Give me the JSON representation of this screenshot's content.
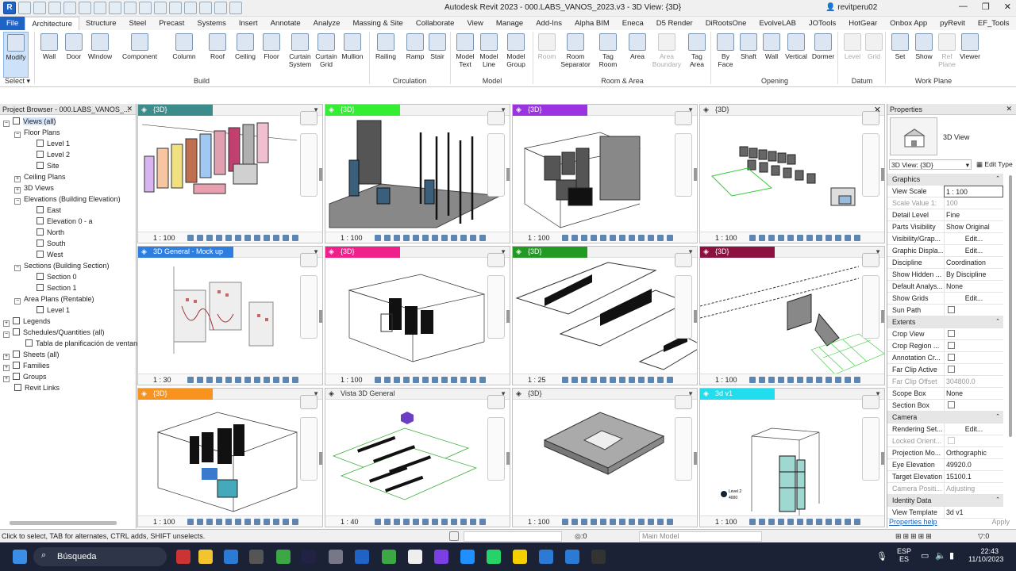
{
  "app": {
    "title": "Autodesk Revit 2023 - 000.LABS_VANOS_2023.v3 - 3D View: {3D}",
    "user": "revitperu02",
    "logo": "R"
  },
  "tabs": [
    "File",
    "Architecture",
    "Structure",
    "Steel",
    "Precast",
    "Systems",
    "Insert",
    "Annotate",
    "Analyze",
    "Massing & Site",
    "Collaborate",
    "View",
    "Manage",
    "Add-Ins",
    "Alpha BIM",
    "Eneca",
    "D5 Render",
    "DiRootsOne",
    "EvolveLAB",
    "JOTools",
    "HotGear",
    "Onbox App",
    "pyRevit",
    "EF_Tools"
  ],
  "ribbon": {
    "buttons": [
      {
        "l1": "Modify",
        "l2": ""
      },
      {
        "l1": "Wall",
        "l2": ""
      },
      {
        "l1": "Door",
        "l2": ""
      },
      {
        "l1": "Window",
        "l2": ""
      },
      {
        "l1": "Component",
        "l2": ""
      },
      {
        "l1": "Column",
        "l2": ""
      },
      {
        "l1": "Roof",
        "l2": ""
      },
      {
        "l1": "Ceiling",
        "l2": ""
      },
      {
        "l1": "Floor",
        "l2": ""
      },
      {
        "l1": "Curtain",
        "l2": "System"
      },
      {
        "l1": "Curtain",
        "l2": "Grid"
      },
      {
        "l1": "Mullion",
        "l2": ""
      },
      {
        "l1": "Railing",
        "l2": ""
      },
      {
        "l1": "Ramp",
        "l2": ""
      },
      {
        "l1": "Stair",
        "l2": ""
      },
      {
        "l1": "Model",
        "l2": "Text"
      },
      {
        "l1": "Model",
        "l2": "Line"
      },
      {
        "l1": "Model",
        "l2": "Group"
      },
      {
        "l1": "Room",
        "l2": ""
      },
      {
        "l1": "Room",
        "l2": "Separator"
      },
      {
        "l1": "Tag",
        "l2": "Room"
      },
      {
        "l1": "Area",
        "l2": ""
      },
      {
        "l1": "Area",
        "l2": "Boundary"
      },
      {
        "l1": "Tag",
        "l2": "Area"
      },
      {
        "l1": "By",
        "l2": "Face"
      },
      {
        "l1": "Shaft",
        "l2": ""
      },
      {
        "l1": "Wall",
        "l2": ""
      },
      {
        "l1": "Vertical",
        "l2": ""
      },
      {
        "l1": "Dormer",
        "l2": ""
      },
      {
        "l1": "Level",
        "l2": ""
      },
      {
        "l1": "Grid",
        "l2": ""
      },
      {
        "l1": "Set",
        "l2": ""
      },
      {
        "l1": "Show",
        "l2": ""
      },
      {
        "l1": "Ref",
        "l2": "Plane"
      },
      {
        "l1": "Viewer",
        "l2": ""
      }
    ],
    "panels": [
      "Select",
      "Build",
      "Circulation",
      "Model",
      "Room & Area",
      "Opening",
      "Datum",
      "Work Plane"
    ]
  },
  "browser": {
    "title": "Project Browser - 000.LABS_VANOS_...",
    "nodes": [
      "Views (all)",
      "Floor Plans",
      "Level 1",
      "Level 2",
      "Site",
      "Ceiling Plans",
      "3D Views",
      "Elevations (Building Elevation)",
      "East",
      "Elevation 0 - a",
      "North",
      "South",
      "West",
      "Sections (Building Section)",
      "Section 0",
      "Section 1",
      "Area Plans (Rentable)",
      "Level 1",
      "Legends",
      "Schedules/Quantities (all)",
      "Tabla de planificación de ventan",
      "Sheets (all)",
      "Families",
      "Groups",
      "Revit Links"
    ]
  },
  "views": [
    {
      "title": "{3D}",
      "color": "#3d8c8c",
      "scale": "1 : 100"
    },
    {
      "title": "{3D}",
      "color": "#33ee33",
      "scale": "1 : 100"
    },
    {
      "title": "{3D}",
      "color": "#9b33e0",
      "scale": "1 : 100"
    },
    {
      "title": "{3D}",
      "color": "",
      "scale": "1 : 100"
    },
    {
      "title": "3D General - Mock up",
      "color": "#2e7ee0",
      "scale": "1 : 30"
    },
    {
      "title": "{3D}",
      "color": "#f0208a",
      "scale": "1 : 100"
    },
    {
      "title": "{3D}",
      "color": "#229922",
      "scale": "1 : 25"
    },
    {
      "title": "{3D}",
      "color": "#8c1040",
      "scale": "1 : 100"
    },
    {
      "title": "{3D}",
      "color": "#f7931e",
      "scale": "1 : 100"
    },
    {
      "title": "Vista 3D General",
      "color": "",
      "scale": "1 : 40"
    },
    {
      "title": "{3D}",
      "color": "",
      "scale": "1 : 100"
    },
    {
      "title": "3d v1",
      "color": "#22ddee",
      "scale": "1 : 100"
    }
  ],
  "canvas_text": {
    "level": "Level 2",
    "elev": "4000"
  },
  "properties": {
    "title": "Properties",
    "type_name": "3D View",
    "selector": "3D View: {3D}",
    "edit_type": "Edit Type",
    "rows": [
      {
        "k": "Graphics",
        "v": "",
        "kind": "sec"
      },
      {
        "k": "View Scale",
        "v": "1 : 100",
        "kind": "inp"
      },
      {
        "k": "Scale Value    1:",
        "v": "100",
        "kind": "dim"
      },
      {
        "k": "Detail Level",
        "v": "Fine",
        "kind": "txt"
      },
      {
        "k": "Parts Visibility",
        "v": "Show Original",
        "kind": "txt"
      },
      {
        "k": "Visibility/Grap...",
        "v": "Edit...",
        "kind": "btn"
      },
      {
        "k": "Graphic Displa...",
        "v": "Edit...",
        "kind": "btn"
      },
      {
        "k": "Discipline",
        "v": "Coordination",
        "kind": "txt"
      },
      {
        "k": "Show Hidden ...",
        "v": "By Discipline",
        "kind": "txt"
      },
      {
        "k": "Default Analys...",
        "v": "None",
        "kind": "txt"
      },
      {
        "k": "Show Grids",
        "v": "Edit...",
        "kind": "btn"
      },
      {
        "k": "Sun Path",
        "v": "",
        "kind": "chk"
      },
      {
        "k": "Extents",
        "v": "",
        "kind": "sec"
      },
      {
        "k": "Crop View",
        "v": "",
        "kind": "chk"
      },
      {
        "k": "Crop Region ...",
        "v": "",
        "kind": "chk"
      },
      {
        "k": "Annotation Cr...",
        "v": "",
        "kind": "chk"
      },
      {
        "k": "Far Clip Active",
        "v": "",
        "kind": "chk"
      },
      {
        "k": "Far Clip Offset",
        "v": "304800.0",
        "kind": "dim"
      },
      {
        "k": "Scope Box",
        "v": "None",
        "kind": "txt"
      },
      {
        "k": "Section Box",
        "v": "",
        "kind": "chk"
      },
      {
        "k": "Camera",
        "v": "",
        "kind": "sec"
      },
      {
        "k": "Rendering Set...",
        "v": "Edit...",
        "kind": "btn"
      },
      {
        "k": "Locked Orient...",
        "v": "",
        "kind": "chkdim"
      },
      {
        "k": "Projection Mo...",
        "v": "Orthographic",
        "kind": "txt"
      },
      {
        "k": "Eye Elevation",
        "v": "49920.0",
        "kind": "txt"
      },
      {
        "k": "Target Elevation",
        "v": "15100.1",
        "kind": "txt"
      },
      {
        "k": "Camera Positi...",
        "v": "Adjusting",
        "kind": "dim"
      },
      {
        "k": "Identity Data",
        "v": "",
        "kind": "sec"
      },
      {
        "k": "View Template",
        "v": "3d v1",
        "kind": "txt"
      }
    ],
    "help": "Properties help",
    "apply": "Apply"
  },
  "status": {
    "hint": "Click to select, TAB for alternates, CTRL adds, SHIFT unselects.",
    "zero": ":0",
    "model": "Main Model",
    "filter": ":0"
  },
  "taskbar": {
    "search": "Búsqueda",
    "lang1": "ESP",
    "lang2": "ES",
    "time": "22:43",
    "date": "11/10/2023"
  }
}
